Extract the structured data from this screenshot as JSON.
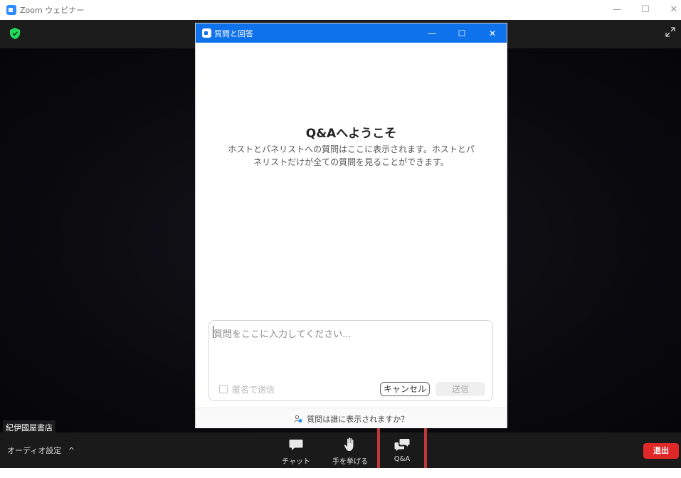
{
  "window": {
    "title": "Zoom ウェビナー",
    "minimize_glyph": "—",
    "maximize_glyph": "☐",
    "close_glyph": "✕"
  },
  "video": {
    "speaker_name": "紀伊國屋書店"
  },
  "toolbar": {
    "audio_settings_label": "オーディオ設定",
    "audio_settings_chevron": "^",
    "chat_label": "チャット",
    "raise_hand_label": "手を挙げる",
    "qa_label": "Q&A",
    "exit_label": "退出"
  },
  "qa_dialog": {
    "title": "質問と回答",
    "minimize_glyph": "—",
    "maximize_glyph": "☐",
    "close_glyph": "✕",
    "welcome_title": "Q&Aへようこそ",
    "welcome_description": "ホストとパネリストへの質問はここに表示されます。ホストとパネリストだけが全ての質問を見ることができます。",
    "input_placeholder": "質問をここに入力してください...",
    "anonymous_label": "匿名で送信",
    "cancel_label": "キャンセル",
    "send_label": "送信",
    "footer_text": "質問は誰に表示されますか？"
  },
  "colors": {
    "qa_titlebar": "#0e72ed",
    "exit_button": "#e02828",
    "highlight_box": "#c0383e",
    "shield": "#23d959"
  },
  "icons": [
    "zoom-app-icon",
    "shield-icon",
    "expand-icon",
    "chat-icon",
    "raise-hand-icon",
    "qa-icon",
    "person-icon",
    "chevron-up-icon"
  ]
}
